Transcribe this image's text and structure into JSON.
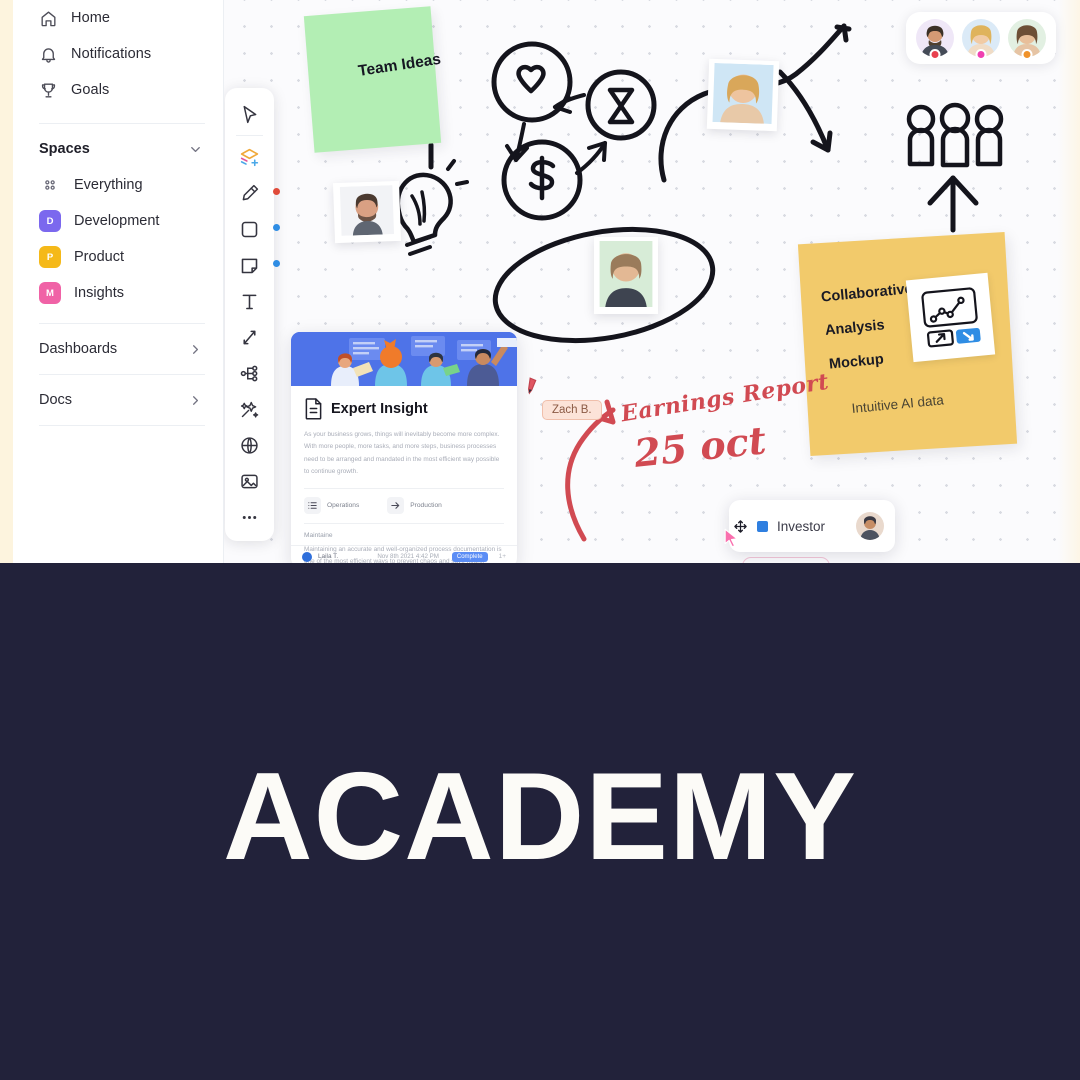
{
  "sidebar": {
    "nav": [
      {
        "label": "Home",
        "icon": "home-icon"
      },
      {
        "label": "Notifications",
        "icon": "bell-icon"
      },
      {
        "label": "Goals",
        "icon": "trophy-icon"
      }
    ],
    "spaces_section": {
      "title": "Spaces",
      "chevron": "chevron-down-icon"
    },
    "spaces": [
      {
        "label": "Everything",
        "badge": "",
        "color": "",
        "icon": "grid-dots-icon"
      },
      {
        "label": "Development",
        "badge": "D",
        "color": "#7b68ee"
      },
      {
        "label": "Product",
        "badge": "P",
        "color": "#f5b919"
      },
      {
        "label": "Insights",
        "badge": "M",
        "color": "#f062a6"
      }
    ],
    "links": [
      {
        "label": "Dashboards",
        "chevron": "chevron-right-icon"
      },
      {
        "label": "Docs",
        "chevron": "chevron-right-icon"
      }
    ]
  },
  "toolbar": {
    "tools": [
      {
        "name": "select-tool",
        "icon": "cursor-icon",
        "dot": ""
      },
      {
        "name": "add-layer-tool",
        "icon": "stack-plus-icon",
        "dot": ""
      },
      {
        "name": "draw-tool",
        "icon": "pen-icon",
        "dot": "#e04b3a"
      },
      {
        "name": "shape-tool",
        "icon": "square-icon",
        "dot": "#2f8de4"
      },
      {
        "name": "sticky-note-tool",
        "icon": "sticky-note-icon",
        "dot": "#2f8de4"
      },
      {
        "name": "text-tool",
        "icon": "text-t-icon",
        "dot": ""
      },
      {
        "name": "connector-tool",
        "icon": "arrows-cross-icon",
        "dot": ""
      },
      {
        "name": "mindmap-tool",
        "icon": "mindmap-icon",
        "dot": ""
      },
      {
        "name": "ai-tool",
        "icon": "magic-wand-icon",
        "dot": ""
      },
      {
        "name": "web-embed-tool",
        "icon": "globe-icon",
        "dot": ""
      },
      {
        "name": "image-tool",
        "icon": "image-icon",
        "dot": ""
      },
      {
        "name": "more-tools",
        "icon": "ellipsis-icon",
        "dot": ""
      }
    ]
  },
  "collaborators": [
    {
      "status_color": "#e8414f"
    },
    {
      "status_color": "#ef3fb0"
    },
    {
      "status_color": "#f0922a"
    }
  ],
  "canvas": {
    "sticky_green": {
      "text": "Team Ideas"
    },
    "sticky_yellow": {
      "line1": "Collaborative",
      "line2": "Analysis",
      "line3": "Mockup",
      "subtitle": "Intuitive AI data",
      "thumb_icon": "line-chart-card-icon"
    },
    "doc_card": {
      "title": "Expert Insight",
      "icon": "document-icon",
      "paragraph": "As your business grows, things will inevitably become more complex. With more people, more tasks, and more steps, business processes need to be arranged and mandated in the most efficient way possible to continue growth.",
      "chips": [
        {
          "label": "Operations",
          "icon": "list-icon"
        },
        {
          "label": "Production",
          "icon": "arrow-right-icon"
        }
      ],
      "section_heading": "Maintaine",
      "section_text": "Maintaining an accurate and well-organized process documentation is one of the most efficient ways to prevent chaos and save hours.",
      "footer": {
        "author": "Laila T.",
        "date": "Nov 8th 2021 4:42 PM",
        "badge": "Complete",
        "more": "1+"
      }
    },
    "zach_tag": {
      "label": "Zach B."
    },
    "handwriting": {
      "title": "Earnings Report",
      "date": "25 oct"
    },
    "investor_card": {
      "label": "Investor",
      "move_icon": "move-handle-icon",
      "checkbox_color": "#2f7fe0"
    }
  },
  "band": {
    "word": "ACADEMY"
  }
}
